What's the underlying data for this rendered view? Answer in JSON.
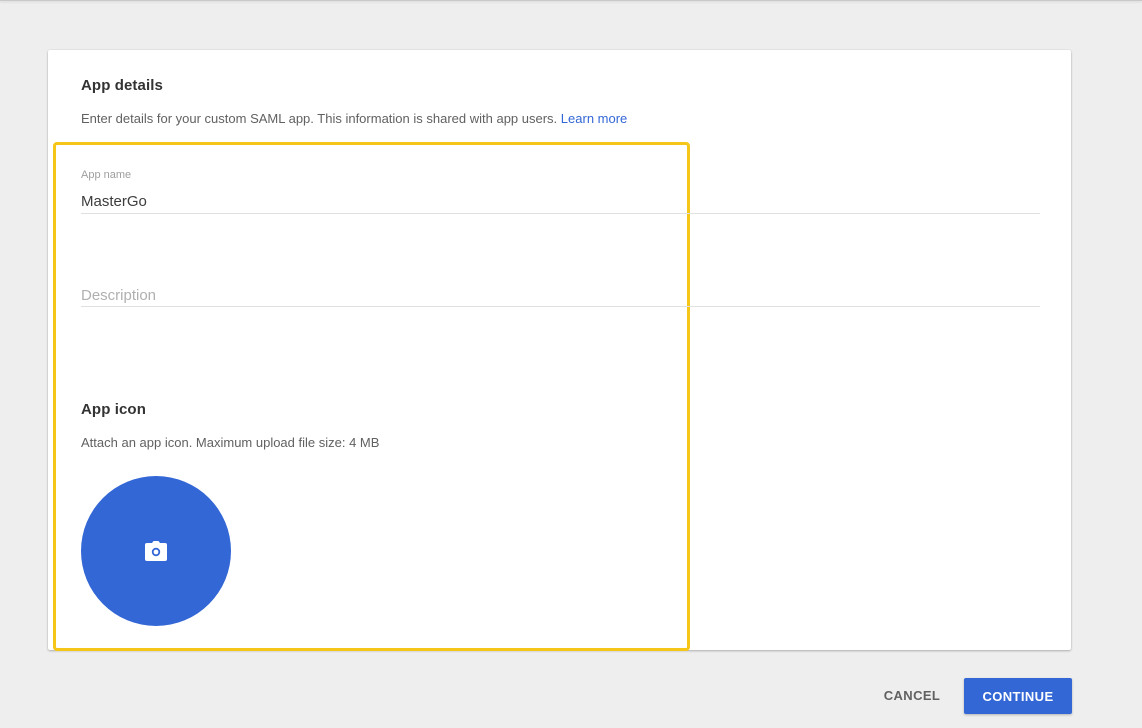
{
  "app_details": {
    "title": "App details",
    "description": "Enter details for your custom SAML app. This information is shared with app users.",
    "learn_more": "Learn more"
  },
  "app_name": {
    "label": "App name",
    "value": "MasterGo"
  },
  "description_field": {
    "placeholder": "Description",
    "value": ""
  },
  "app_icon": {
    "title": "App icon",
    "description": "Attach an app icon. Maximum upload file size: 4 MB",
    "icon": "camera-icon"
  },
  "actions": {
    "cancel_label": "CANCEL",
    "continue_label": "CONTINUE"
  },
  "colors": {
    "accent": "#3367d6",
    "highlight": "#f5c518",
    "background": "#eeeeee"
  }
}
